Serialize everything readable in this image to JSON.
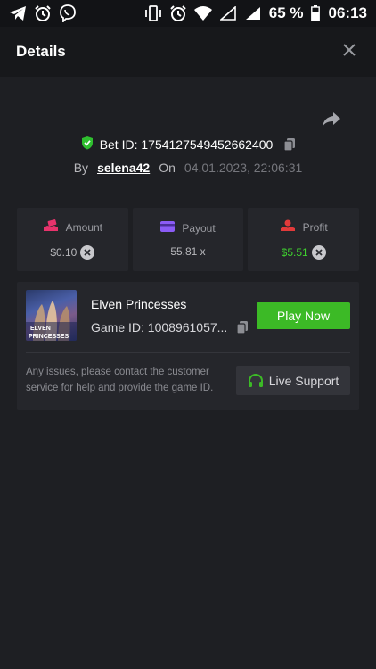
{
  "status_bar": {
    "icons_left": [
      "telegram-icon",
      "alarm-icon",
      "viber-icon"
    ],
    "icons_right": [
      "vibrate-icon",
      "alarm-icon",
      "wifi-icon",
      "signal-empty-icon",
      "signal-icon"
    ],
    "battery_percent": "65 %",
    "time": "06:13"
  },
  "header": {
    "title": "Details"
  },
  "bet": {
    "bet_id_label": "Bet ID: 1754127549452662400",
    "by_label": "By",
    "username": "selena42",
    "on_label": "On",
    "date": "04.01.2023, 22:06:31"
  },
  "stats": [
    {
      "label": "Amount",
      "value": "$0.10",
      "icon": "money-hand-icon",
      "color": "#e8336c"
    },
    {
      "label": "Payout",
      "value": "55.81 x",
      "icon": "card-icon",
      "color": "#8b5cf6"
    },
    {
      "label": "Profit",
      "value": "$5.51",
      "icon": "profit-hand-icon",
      "color": "#e23a3a"
    }
  ],
  "game": {
    "title": "Elven Princesses",
    "game_id": "Game ID: 1008961057...",
    "play_label": "Play Now",
    "thumb_text_1": "ELVEN",
    "thumb_text_2": "PRINCESSES"
  },
  "support": {
    "text": "Any issues, please contact the customer service for help and provide the game ID.",
    "button_label": "Live Support"
  },
  "colors": {
    "accent_green": "#3cba26",
    "profit_green": "#3fd12f",
    "background": "#1e1f23"
  }
}
